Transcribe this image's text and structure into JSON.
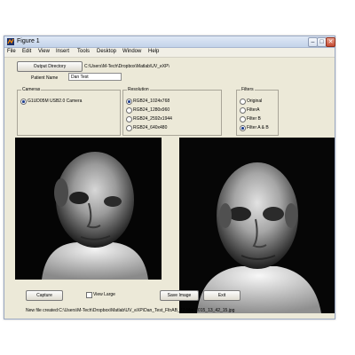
{
  "window": {
    "title": "Figure 1",
    "controls": [
      "–",
      "□",
      "✕"
    ]
  },
  "menu": [
    "File",
    "Edit",
    "View",
    "Insert",
    "Tools",
    "Desktop",
    "Window",
    "Help"
  ],
  "output": {
    "button": "Output Directory",
    "path": "C:\\Users\\M-Tech\\Dropbox\\Matlab\\UV_eXP\\"
  },
  "patient": {
    "label": "Patient Name",
    "value": "Dan Test"
  },
  "cameras": {
    "title": "Cameras",
    "options": [
      {
        "label": "G1UD05M USB2.0 Camera",
        "selected": true
      }
    ]
  },
  "resolution": {
    "title": "Resolution",
    "options": [
      {
        "label": "RGB24_1024x768",
        "selected": true
      },
      {
        "label": "RGB24_1280x960",
        "selected": false
      },
      {
        "label": "RGB24_2592x1944",
        "selected": false
      },
      {
        "label": "RGB24_640x480",
        "selected": false
      }
    ]
  },
  "filters": {
    "title": "Filters",
    "options": [
      {
        "label": "Original",
        "selected": false
      },
      {
        "label": "FilterA",
        "selected": false
      },
      {
        "label": "Filter B",
        "selected": false
      },
      {
        "label": "Filter A & B",
        "selected": true
      }
    ]
  },
  "controls": {
    "capture": "Capture",
    "view_large": "View Large",
    "save_image": "Save Image",
    "exit": "Exit"
  },
  "status": "New file created:C:\\Users\\M-Tech\\Dropbox\\Matlab\\UV_eXP\\Dan_Test_FltrAB_27-Mar-2015_13_42_15.jpg"
}
